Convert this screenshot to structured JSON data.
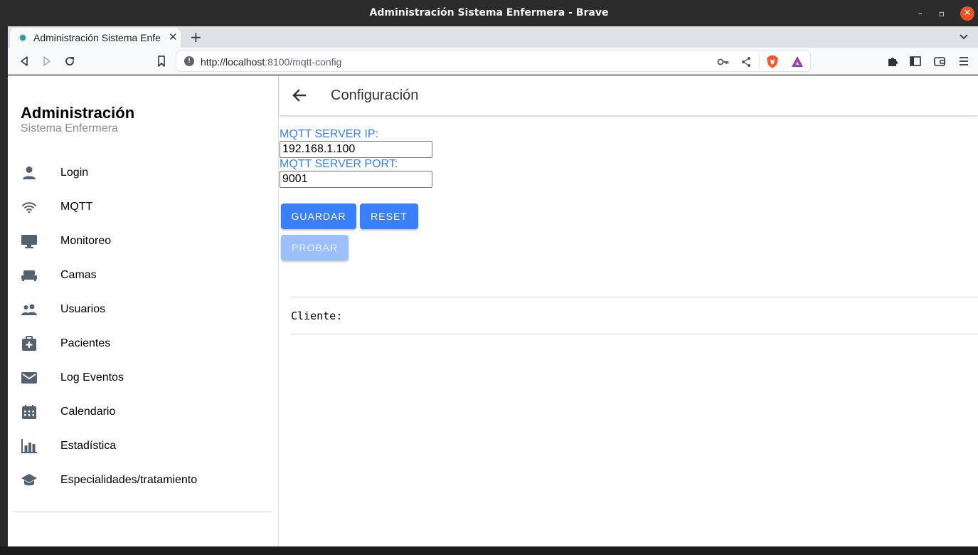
{
  "window": {
    "title": "Administración Sistema Enfermera - Brave",
    "minimize_icon": "minimize-icon",
    "maximize_icon": "maximize-icon",
    "close_icon": "close-icon"
  },
  "browser": {
    "tab_title": "Administración Sistema Enfermera",
    "tab_close": "✕",
    "new_tab": "+",
    "url_host": "http://localhost",
    "url_rest": ":8100/mqtt-config"
  },
  "menu": {
    "title": "Administración",
    "subtitle": "Sistema Enfermera",
    "items": [
      {
        "label": "Login",
        "icon": "person-icon"
      },
      {
        "label": "MQTT",
        "icon": "wifi-icon"
      },
      {
        "label": "Monitoreo",
        "icon": "desktop-icon"
      },
      {
        "label": "Camas",
        "icon": "bed-icon"
      },
      {
        "label": "Usuarios",
        "icon": "people-icon"
      },
      {
        "label": "Pacientes",
        "icon": "medkit-icon"
      },
      {
        "label": "Log Eventos",
        "icon": "mail-icon"
      },
      {
        "label": "Calendario",
        "icon": "calendar-icon"
      },
      {
        "label": "Estadística",
        "icon": "stats-chart-icon"
      },
      {
        "label": "Especialidades/tratamiento",
        "icon": "school-icon"
      }
    ]
  },
  "header": {
    "title": "Configuración"
  },
  "form": {
    "ip_label": "MQTT SERVER IP:",
    "ip_value": "192.168.1.100",
    "port_label": "MQTT SERVER PORT:",
    "port_value": "9001",
    "save_label": "GUARDAR",
    "reset_label": "RESET",
    "test_label": "PROBAR"
  },
  "client": {
    "label": "Cliente:"
  },
  "colors": {
    "primary": "#3880ff",
    "primary_disabled": "#9cc0ff",
    "icon_gray": "#54616f"
  }
}
